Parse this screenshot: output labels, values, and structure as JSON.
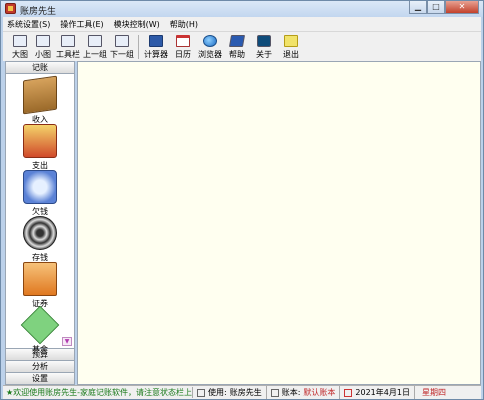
{
  "window": {
    "title": "账房先生"
  },
  "window_controls": {
    "minimize": "▁",
    "maximize": "□",
    "close": "✕"
  },
  "menu": [
    "系统设置(S)",
    "操作工具(E)",
    "模块控制(W)",
    "帮助(H)"
  ],
  "toolbar": {
    "items": [
      {
        "label": "大图",
        "icon": "large-icons-icon"
      },
      {
        "label": "小图",
        "icon": "small-icons-icon"
      },
      {
        "label": "工具栏",
        "icon": "toolbar-icon"
      },
      {
        "label": "上一组",
        "icon": "previous-group-icon"
      },
      {
        "label": "下一组",
        "icon": "next-group-icon"
      },
      {
        "label": "计算器",
        "icon": "calculator-icon"
      },
      {
        "label": "日历",
        "icon": "calendar-icon"
      },
      {
        "label": "浏览器",
        "icon": "browser-icon"
      },
      {
        "label": "帮助",
        "icon": "help-icon"
      },
      {
        "label": "关于",
        "icon": "about-icon"
      },
      {
        "label": "退出",
        "icon": "exit-icon"
      }
    ]
  },
  "leftpanel": {
    "header": "记账",
    "items": [
      {
        "label": "收入",
        "icon": "income-box-icon"
      },
      {
        "label": "支出",
        "icon": "expense-box-icon"
      },
      {
        "label": "欠钱",
        "icon": "debt-icon"
      },
      {
        "label": "存钱",
        "icon": "savings-disc-icon"
      },
      {
        "label": "证券",
        "icon": "securities-icon"
      },
      {
        "label": "基金",
        "icon": "fund-icon"
      }
    ],
    "tabs": [
      "预算",
      "分析",
      "设置"
    ]
  },
  "statusbar": {
    "marquee": "★欢迎使用账房先生-家庭记账软件，请注意状态栏上的",
    "user_label": "使用:",
    "user_value": "账房先生",
    "book_label": "账本:",
    "book_value": "默认账本",
    "date": "2021年4月1日",
    "weekday": "星期四"
  },
  "colors": {
    "content_bg": "#fffff0",
    "marquee_text": "#1a7a1a",
    "accent_red": "#c0282a"
  }
}
